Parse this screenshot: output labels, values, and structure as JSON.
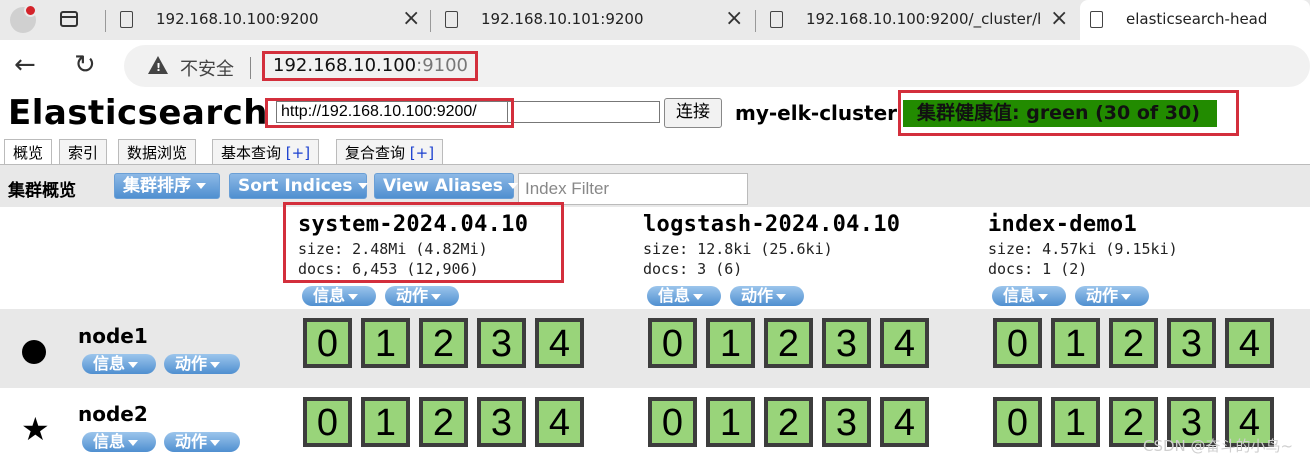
{
  "browser": {
    "tabs": [
      {
        "title": "192.168.10.100:9200"
      },
      {
        "title": "192.168.10.101:9200"
      },
      {
        "title": "192.168.10.100:9200/_cluster/hea"
      },
      {
        "title": "elasticsearch-head"
      }
    ],
    "security_label": "不安全",
    "url_host": "192.168.10.100",
    "url_port": ":9100"
  },
  "head": {
    "brand": "Elasticsearch",
    "connect_url": "http://192.168.10.100:9200/",
    "connect_label": "连接",
    "cluster_name": "my-elk-cluster",
    "health": "集群健康值: green (30 of 30)"
  },
  "tabs": [
    {
      "label": "概览"
    },
    {
      "label": "索引"
    },
    {
      "label": "数据浏览"
    },
    {
      "label": "基本查询",
      "plus": "[+]"
    },
    {
      "label": "复合查询",
      "plus": "[+]"
    }
  ],
  "toolbar": {
    "title": "集群概览",
    "sort_cluster": "集群排序",
    "sort_indices": "Sort Indices",
    "view_aliases": "View Aliases",
    "filter_placeholder": "Index Filter"
  },
  "indices": [
    {
      "name": "system-2024.04.10",
      "size": "size: 2.48Mi (4.82Mi)",
      "docs": "docs: 6,453 (12,906)",
      "info": "信息",
      "action": "动作"
    },
    {
      "name": "logstash-2024.04.10",
      "size": "size: 12.8ki (25.6ki)",
      "docs": "docs: 3 (6)",
      "info": "信息",
      "action": "动作"
    },
    {
      "name": "index-demo1",
      "size": "size: 4.57ki (9.15ki)",
      "docs": "docs: 1 (2)",
      "info": "信息",
      "action": "动作"
    }
  ],
  "nodes": [
    {
      "name": "node1",
      "icon": "master-dot-icon",
      "info": "信息",
      "action": "动作",
      "shards": [
        "0",
        "1",
        "2",
        "3",
        "4"
      ]
    },
    {
      "name": "node2",
      "icon": "star-icon",
      "info": "信息",
      "action": "动作",
      "shards": [
        "0",
        "1",
        "2",
        "3",
        "4"
      ]
    }
  ],
  "watermark": "CSDN @奋斗的小鸟~",
  "colors": {
    "health_green": "#228B00",
    "shard_green": "#99d47a",
    "highlight_red": "#d32f3c",
    "button_blue": "#4f8fd0"
  }
}
